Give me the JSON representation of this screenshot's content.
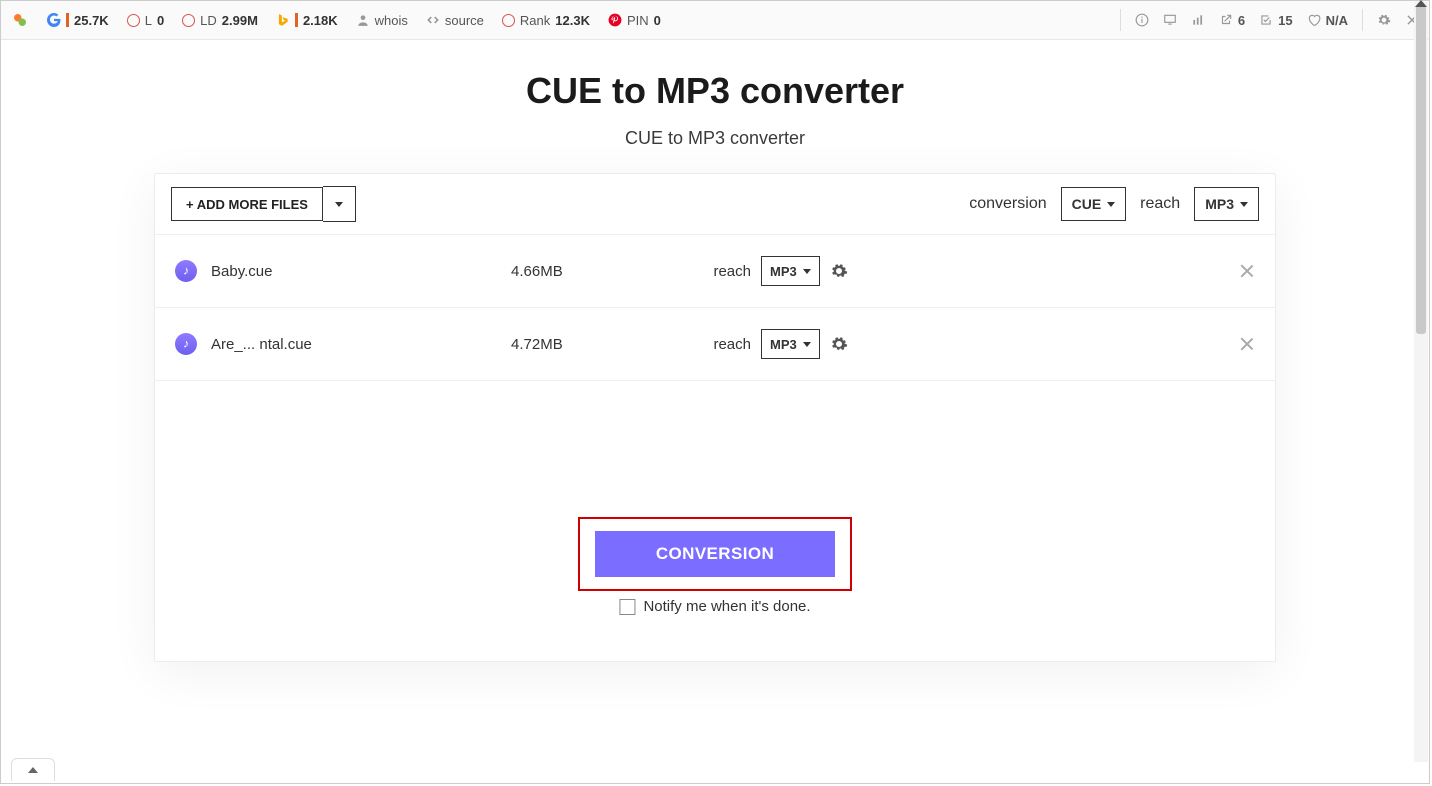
{
  "toolbar": {
    "left": [
      {
        "icon": "so-logo",
        "label": "",
        "value": ""
      },
      {
        "icon": "google",
        "label": "",
        "value": "25.7K",
        "bar": true
      },
      {
        "icon": "circle-red",
        "label": "L",
        "value": "0"
      },
      {
        "icon": "circle-red",
        "label": "LD",
        "value": "2.99M"
      },
      {
        "icon": "bing",
        "label": "",
        "value": "2.18K",
        "bar": true
      },
      {
        "icon": "person",
        "label": "whois",
        "value": ""
      },
      {
        "icon": "code",
        "label": "source",
        "value": ""
      },
      {
        "icon": "circle-red",
        "label": "Rank",
        "value": "12.3K"
      },
      {
        "icon": "pinterest",
        "label": "PIN",
        "value": "0"
      }
    ],
    "right": [
      {
        "icon": "info",
        "label": "",
        "value": ""
      },
      {
        "icon": "monitor",
        "label": "",
        "value": ""
      },
      {
        "icon": "chart",
        "label": "",
        "value": ""
      },
      {
        "icon": "external",
        "label": "",
        "value": "6"
      },
      {
        "icon": "check-ext",
        "label": "",
        "value": "15"
      },
      {
        "icon": "heart",
        "label": "",
        "value": "N/A"
      },
      {
        "icon": "gear",
        "label": "",
        "value": ""
      },
      {
        "icon": "close",
        "label": "",
        "value": ""
      }
    ]
  },
  "page": {
    "title": "CUE to MP3 converter",
    "subtitle": "CUE to MP3 converter"
  },
  "card": {
    "add_button": "+ ADD MORE FILES",
    "conversion_label": "conversion",
    "from_select": "CUE",
    "reach_label": "reach",
    "to_select": "MP3",
    "files": [
      {
        "name": "Baby.cue",
        "size": "4.66MB",
        "reach": "reach",
        "fmt": "MP3"
      },
      {
        "name": "Are_... ntal.cue",
        "size": "4.72MB",
        "reach": "reach",
        "fmt": "MP3"
      }
    ],
    "convert_button": "CONVERSION",
    "notify_label": "Notify me when it's done."
  }
}
